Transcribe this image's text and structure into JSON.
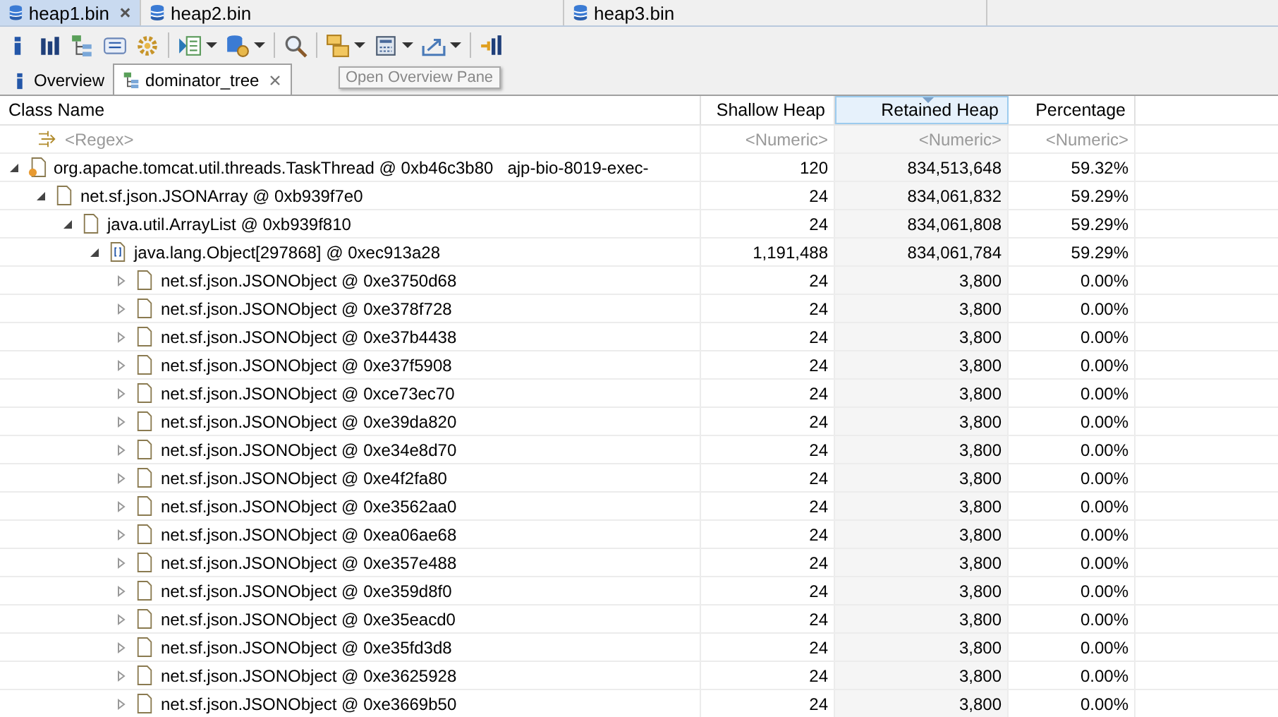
{
  "editor_tabs": [
    {
      "label": "heap1.bin",
      "selected": true,
      "closable": true
    },
    {
      "label": "heap2.bin",
      "selected": false,
      "closable": false
    },
    {
      "label": "heap3.bin",
      "selected": false,
      "closable": false
    }
  ],
  "view_tabs": [
    {
      "label": "Overview",
      "kind": "info",
      "selected": false,
      "closable": false
    },
    {
      "label": "dominator_tree",
      "kind": "tree",
      "selected": true,
      "closable": true
    }
  ],
  "tooltip": "Open Overview Pane",
  "table": {
    "columns": [
      {
        "label": "Class Name",
        "sorted": false
      },
      {
        "label": "Shallow Heap",
        "sorted": false
      },
      {
        "label": "Retained Heap",
        "sorted": true
      },
      {
        "label": "Percentage",
        "sorted": false
      }
    ],
    "filters": [
      "<Regex>",
      "<Numeric>",
      "<Numeric>",
      "<Numeric>"
    ],
    "tree": [
      {
        "name": "org.apache.tomcat.util.threads.TaskThread @ 0xb46c3b80",
        "detail": "ajp-bio-8019-exec-",
        "kind": "thread",
        "expanded": true,
        "shallow": "120",
        "retained": "834,513,648",
        "percentage": "59.32%",
        "children": [
          {
            "name": "net.sf.json.JSONArray @ 0xb939f7e0",
            "kind": "object",
            "expanded": true,
            "shallow": "24",
            "retained": "834,061,832",
            "percentage": "59.29%",
            "children": [
              {
                "name": "java.util.ArrayList @ 0xb939f810",
                "kind": "object",
                "expanded": true,
                "shallow": "24",
                "retained": "834,061,808",
                "percentage": "59.29%",
                "children": [
                  {
                    "name": "java.lang.Object[297868] @ 0xec913a28",
                    "kind": "array",
                    "expanded": true,
                    "shallow": "1,191,488",
                    "retained": "834,061,784",
                    "percentage": "59.29%",
                    "children": [
                      {
                        "name": "net.sf.json.JSONObject @ 0xe3750d68",
                        "kind": "object",
                        "expanded": false,
                        "shallow": "24",
                        "retained": "3,800",
                        "percentage": "0.00%"
                      },
                      {
                        "name": "net.sf.json.JSONObject @ 0xe378f728",
                        "kind": "object",
                        "expanded": false,
                        "shallow": "24",
                        "retained": "3,800",
                        "percentage": "0.00%"
                      },
                      {
                        "name": "net.sf.json.JSONObject @ 0xe37b4438",
                        "kind": "object",
                        "expanded": false,
                        "shallow": "24",
                        "retained": "3,800",
                        "percentage": "0.00%"
                      },
                      {
                        "name": "net.sf.json.JSONObject @ 0xe37f5908",
                        "kind": "object",
                        "expanded": false,
                        "shallow": "24",
                        "retained": "3,800",
                        "percentage": "0.00%"
                      },
                      {
                        "name": "net.sf.json.JSONObject @ 0xce73ec70",
                        "kind": "object",
                        "expanded": false,
                        "shallow": "24",
                        "retained": "3,800",
                        "percentage": "0.00%"
                      },
                      {
                        "name": "net.sf.json.JSONObject @ 0xe39da820",
                        "kind": "object",
                        "expanded": false,
                        "shallow": "24",
                        "retained": "3,800",
                        "percentage": "0.00%"
                      },
                      {
                        "name": "net.sf.json.JSONObject @ 0xe34e8d70",
                        "kind": "object",
                        "expanded": false,
                        "shallow": "24",
                        "retained": "3,800",
                        "percentage": "0.00%"
                      },
                      {
                        "name": "net.sf.json.JSONObject @ 0xe4f2fa80",
                        "kind": "object",
                        "expanded": false,
                        "shallow": "24",
                        "retained": "3,800",
                        "percentage": "0.00%"
                      },
                      {
                        "name": "net.sf.json.JSONObject @ 0xe3562aa0",
                        "kind": "object",
                        "expanded": false,
                        "shallow": "24",
                        "retained": "3,800",
                        "percentage": "0.00%"
                      },
                      {
                        "name": "net.sf.json.JSONObject @ 0xea06ae68",
                        "kind": "object",
                        "expanded": false,
                        "shallow": "24",
                        "retained": "3,800",
                        "percentage": "0.00%"
                      },
                      {
                        "name": "net.sf.json.JSONObject @ 0xe357e488",
                        "kind": "object",
                        "expanded": false,
                        "shallow": "24",
                        "retained": "3,800",
                        "percentage": "0.00%"
                      },
                      {
                        "name": "net.sf.json.JSONObject @ 0xe359d8f0",
                        "kind": "object",
                        "expanded": false,
                        "shallow": "24",
                        "retained": "3,800",
                        "percentage": "0.00%"
                      },
                      {
                        "name": "net.sf.json.JSONObject @ 0xe35eacd0",
                        "kind": "object",
                        "expanded": false,
                        "shallow": "24",
                        "retained": "3,800",
                        "percentage": "0.00%"
                      },
                      {
                        "name": "net.sf.json.JSONObject @ 0xe35fd3d8",
                        "kind": "object",
                        "expanded": false,
                        "shallow": "24",
                        "retained": "3,800",
                        "percentage": "0.00%"
                      },
                      {
                        "name": "net.sf.json.JSONObject @ 0xe3625928",
                        "kind": "object",
                        "expanded": false,
                        "shallow": "24",
                        "retained": "3,800",
                        "percentage": "0.00%"
                      },
                      {
                        "name": "net.sf.json.JSONObject @ 0xe3669b50",
                        "kind": "object",
                        "expanded": false,
                        "shallow": "24",
                        "retained": "3,800",
                        "percentage": "0.00%"
                      }
                    ]
                  }
                ]
              }
            ]
          }
        ]
      }
    ]
  }
}
